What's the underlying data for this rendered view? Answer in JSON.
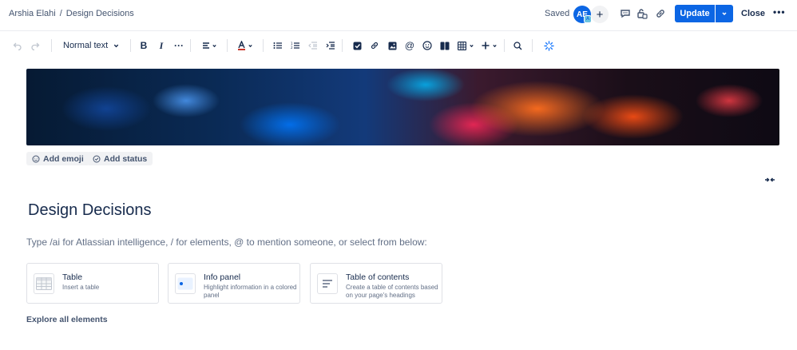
{
  "breadcrumb": {
    "space": "Arshia Elahi",
    "separator": "/",
    "page": "Design Decisions"
  },
  "header": {
    "saved_label": "Saved",
    "avatar_initials": "AE",
    "avatar_badge": "A",
    "add_icon": "plus-icon",
    "update_label": "Update",
    "close_label": "Close"
  },
  "toolbar": {
    "text_style": "Normal text",
    "icons": [
      "undo-icon",
      "redo-icon",
      "bold-icon",
      "italic-icon",
      "more-formatting-icon",
      "align-icon",
      "text-color-icon",
      "bullet-list-icon",
      "numbered-list-icon",
      "outdent-icon",
      "indent-icon",
      "task-icon",
      "link-icon",
      "image-icon",
      "mention-icon",
      "emoji-icon",
      "layout-icon",
      "table-icon",
      "insert-icon",
      "find-icon",
      "ai-icon"
    ]
  },
  "chips": {
    "add_emoji": "Add emoji",
    "add_status": "Add status"
  },
  "page": {
    "title": "Design Decisions",
    "prompt": "Type /ai for Atlassian intelligence, / for elements, @ to mention someone, or select from below:"
  },
  "cards": [
    {
      "title": "Table",
      "desc": "Insert a table"
    },
    {
      "title": "Info panel",
      "desc": "Highlight information in a colored panel"
    },
    {
      "title": "Table of contents",
      "desc": "Create a table of contents based on your page's headings"
    }
  ],
  "explore_label": "Explore all elements",
  "colors": {
    "primary": "#0c66e4",
    "text": "#172b4d",
    "subtle": "#626f86"
  }
}
